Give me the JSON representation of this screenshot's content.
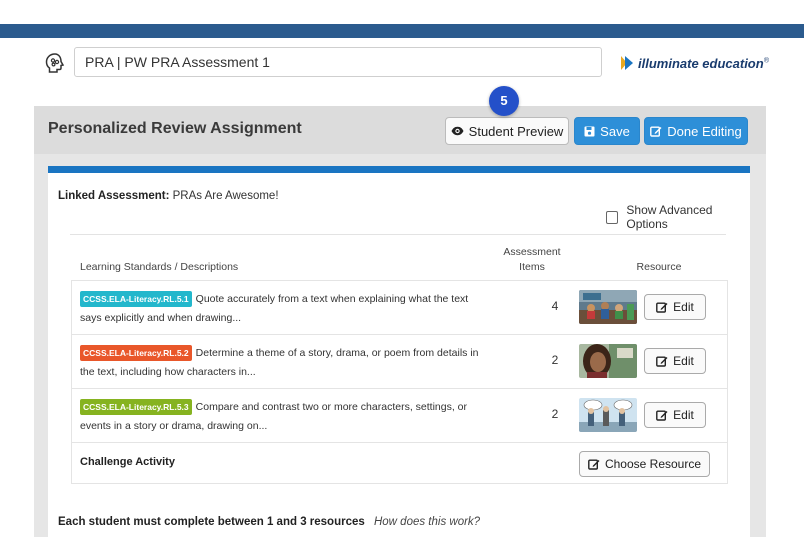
{
  "colors": {
    "top_stripe": "#2b5b8e",
    "primary_button": "#2d8fd8",
    "card_bar": "#1a75c2",
    "badge": "#2450c9"
  },
  "header": {
    "assessment_title_value": "PRA | PW PRA Assessment 1",
    "brand": "illuminate education",
    "brand_mark": "®"
  },
  "badge": {
    "number": "5"
  },
  "panel": {
    "title": "Personalized Review Assignment",
    "buttons": {
      "student_preview": "Student Preview",
      "save": "Save",
      "done_editing": "Done Editing"
    }
  },
  "card": {
    "linked_label": "Linked Assessment:",
    "linked_value": "PRAs Are Awesome!",
    "advanced_options_label": "Show Advanced Options",
    "advanced_options_checked": false,
    "columns": {
      "standards": "Learning Standards / Descriptions",
      "items_line1": "Assessment",
      "items_line2": "Items",
      "resource": "Resource"
    },
    "rows": [
      {
        "tag": "CCSS.ELA-Literacy.RL.5.1",
        "tag_color": "#23b7cc",
        "description": "Quote accurately from a text when explaining what the text says explicitly and when drawing...",
        "items": "4",
        "edit_label": "Edit",
        "thumbnail_icon": "classroom-video-thumbnail"
      },
      {
        "tag": "CCSS.ELA-Literacy.RL.5.2",
        "tag_color": "#e9572a",
        "description": "Determine a theme of a story, drama, or poem from details in the text, including how characters in...",
        "items": "2",
        "edit_label": "Edit",
        "thumbnail_icon": "teacher-video-thumbnail"
      },
      {
        "tag": "CCSS.ELA-Literacy.RL.5.3",
        "tag_color": "#86b320",
        "description": "Compare and contrast two or more characters, settings, or events in a story or drama, drawing on...",
        "items": "2",
        "edit_label": "Edit",
        "thumbnail_icon": "comic-video-thumbnail"
      }
    ],
    "challenge": {
      "label": "Challenge Activity",
      "button": "Choose Resource"
    },
    "footer": {
      "requirement": "Each student must complete between 1 and 3 resources",
      "help_link": "How does this work?"
    }
  }
}
